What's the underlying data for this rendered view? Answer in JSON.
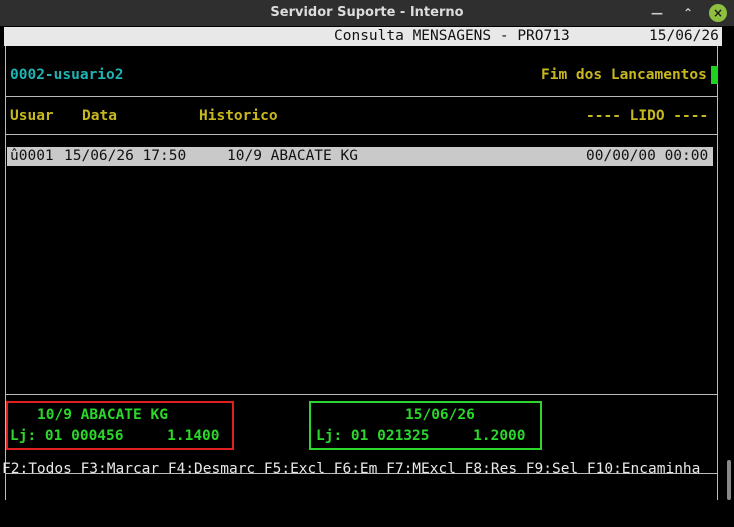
{
  "window": {
    "title": "Servidor Suporte - Interno"
  },
  "header": {
    "screen_title": "Consulta MENSAGENS - PRO713",
    "date": "15/06/26"
  },
  "user": "0002-usuario2",
  "status_text": "Fim dos Lancamentos",
  "columns": {
    "usuar": "Usuar",
    "data": "Data",
    "historico": "Historico",
    "lido": "---- LIDO ----"
  },
  "rows": [
    {
      "user": "û0001",
      "datetime": "15/06/26 17:50",
      "historico": "10/9 ABACATE KG",
      "lido": "00/00/00 00:00"
    }
  ],
  "detail_left": {
    "line1": "10/9 ABACATE KG",
    "line2": "Lj: 01 000456     1.1400"
  },
  "detail_right": {
    "line1": "15/06/26",
    "line2": "Lj: 01 021325     1.2000"
  },
  "fkeys": "F2:Todos F3:Marcar F4:Desmarc F5:Excl F6:Em F7:MExcl F8:Res F9:Sel F10:Encaminha",
  "colors": {
    "accent_cyan": "#1fb4b4",
    "accent_yellow": "#c8b820",
    "green": "#2bd72b",
    "red": "#e02020"
  }
}
